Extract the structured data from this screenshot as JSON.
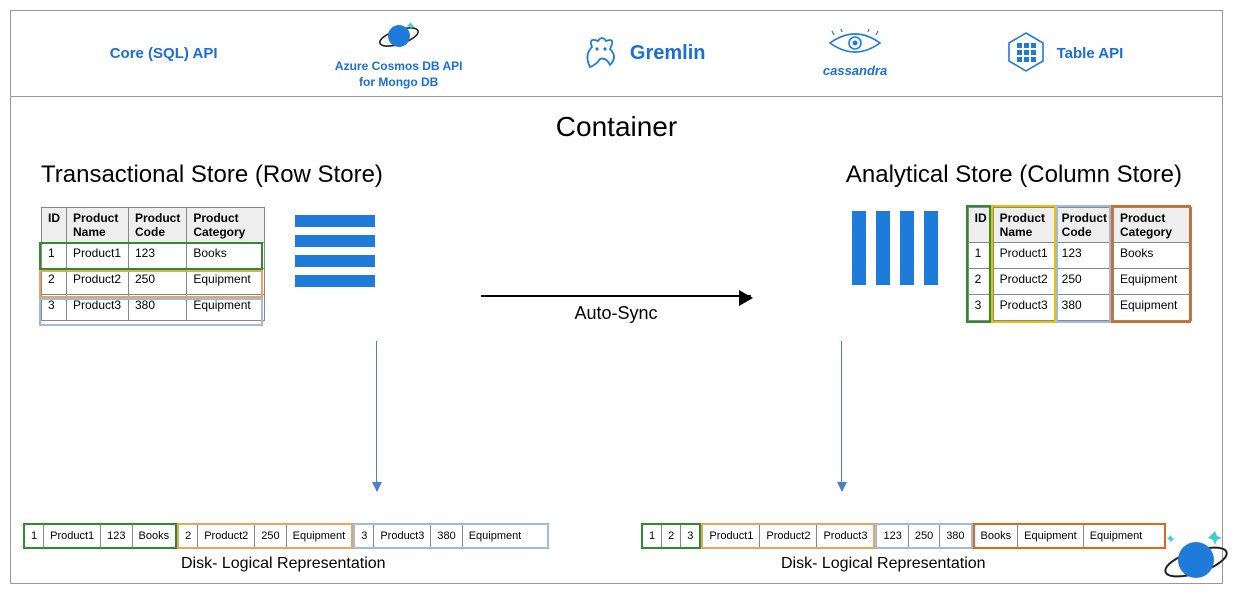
{
  "apis": {
    "core": "Core (SQL) API",
    "mongo_line1": "Azure Cosmos DB API",
    "mongo_line2": "for Mongo DB",
    "gremlin": "Gremlin",
    "cassandra": "cassandra",
    "table": "Table API"
  },
  "container_title": "Container",
  "left_title": "Transactional Store (Row Store)",
  "right_title": "Analytical Store (Column Store)",
  "arrow_label": "Auto-Sync",
  "disk_label": "Disk- Logical Representation",
  "table": {
    "headers": {
      "id": "ID",
      "name": "Product Name",
      "code": "Product Code",
      "cat": "Product Category"
    },
    "rows": [
      {
        "id": "1",
        "name": "Product1",
        "code": "123",
        "cat": "Books"
      },
      {
        "id": "2",
        "name": "Product2",
        "code": "250",
        "cat": "Equipment"
      },
      {
        "id": "3",
        "name": "Product3",
        "code": "380",
        "cat": "Equipment"
      }
    ]
  },
  "disk_left": {
    "g": [
      "1",
      "Product1",
      "123",
      "Books"
    ],
    "o": [
      "2",
      "Product2",
      "250",
      "Equipment"
    ],
    "b": [
      "3",
      "Product3",
      "380",
      "Equipment"
    ]
  },
  "disk_right": {
    "ids": [
      "1",
      "2",
      "3"
    ],
    "names": [
      "Product1",
      "Product2",
      "Product3"
    ],
    "codes": [
      "123",
      "250",
      "380"
    ],
    "cats": [
      "Books",
      "Equipment",
      "Equipment"
    ]
  },
  "colors": {
    "green": "#2e8b2e",
    "orange": "#e8a55b",
    "blue": "#9fb9e0",
    "yellow": "#e8c100",
    "dorange": "#d96a1e"
  }
}
